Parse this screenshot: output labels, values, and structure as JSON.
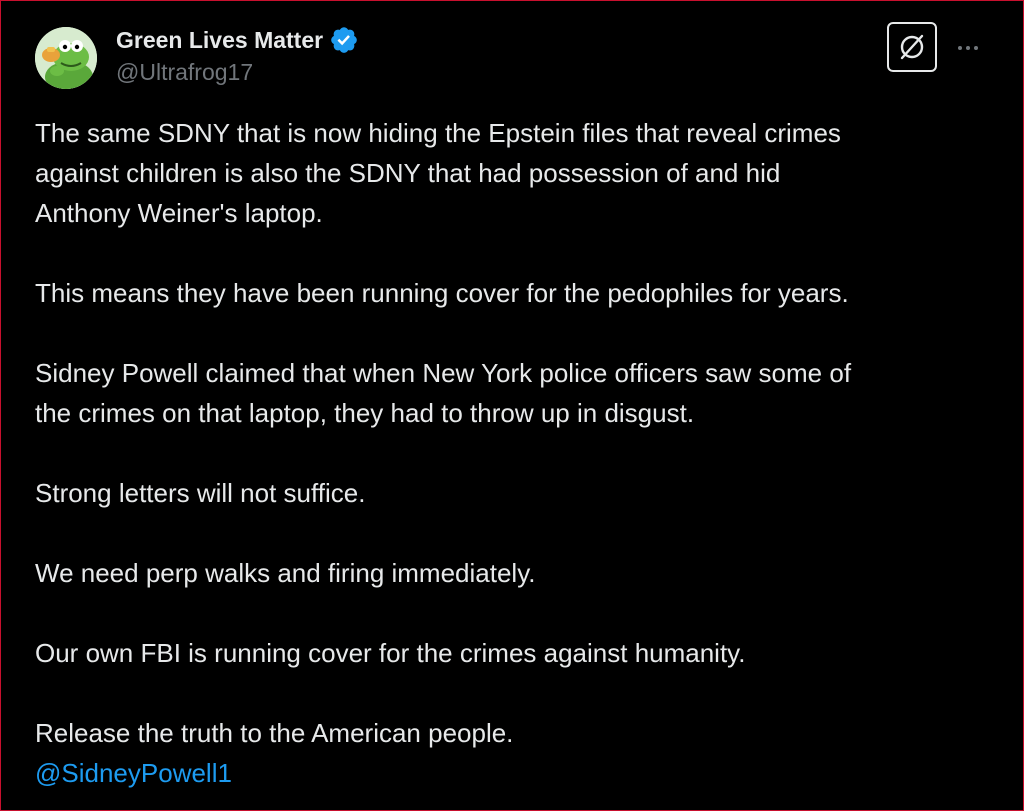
{
  "post": {
    "author": {
      "display_name": "Green Lives Matter",
      "handle": "@Ultrafrog17",
      "verified": true,
      "avatar_icon": "frog-drinking-tea-avatar"
    },
    "actions": {
      "grok_icon": "grok-slash-circle-icon",
      "more_icon": "more-ellipsis-icon"
    },
    "paragraphs": [
      {
        "lines": [
          "The same SDNY that is now hiding the Epstein files that reveal crimes",
          "against children is also the SDNY that had possession of and hid",
          "Anthony Weiner's laptop."
        ]
      },
      {
        "lines": [
          "This means they have been running cover for the pedophiles for years."
        ]
      },
      {
        "lines": [
          "Sidney Powell claimed that when New York police officers saw some of",
          "the crimes on that laptop, they had to throw up in disgust."
        ]
      },
      {
        "lines": [
          "Strong letters will not suffice."
        ]
      },
      {
        "lines": [
          "We need perp walks and firing immediately."
        ]
      },
      {
        "lines": [
          "Our own FBI is running cover for the crimes against humanity."
        ]
      },
      {
        "lines": [
          "Release the truth to the American people."
        ],
        "mention": "@SidneyPowell1"
      }
    ]
  },
  "colors": {
    "background": "#000000",
    "text": "#e7e9ea",
    "secondary_text": "#71767b",
    "link": "#1d9bf0",
    "verified_badge": "#1d9bf0",
    "frame_border": "#c8102e"
  }
}
